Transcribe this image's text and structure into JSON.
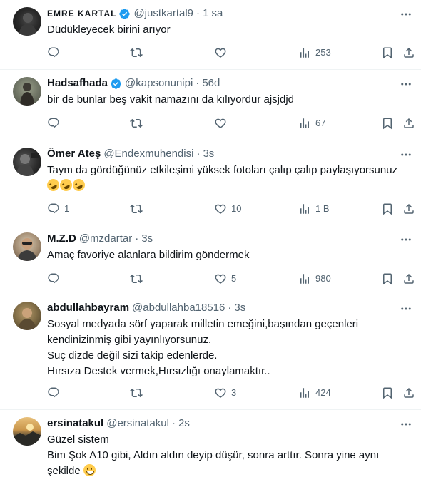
{
  "colors": {
    "text": "#0f1419",
    "secondary": "#536471",
    "verified_badge": "#1d9bf0",
    "divider": "#eff3f4"
  },
  "icons": {
    "reply": "reply-icon",
    "retweet": "retweet-icon",
    "like": "heart-icon",
    "views": "views-chart-icon",
    "bookmark": "bookmark-icon",
    "share": "share-icon",
    "more": "more-options-icon"
  },
  "tweets": [
    {
      "display_name": "ΕΜRΕ ΚΑRΤΑL",
      "verified": true,
      "handle": "@justkartal9",
      "time": "1 sa",
      "lines": [
        "Düdükleyecek birini arıyor"
      ],
      "replies": "",
      "retweets": "",
      "likes": "",
      "views": "253"
    },
    {
      "display_name": "Hadsafhada",
      "verified": true,
      "handle": "@kapsonunipi",
      "time": "56d",
      "lines": [
        "bir de bunlar beş vakit namazını da kılıyordur ajsjdjd"
      ],
      "replies": "",
      "retweets": "",
      "likes": "",
      "views": "67"
    },
    {
      "display_name": "Ömer Ateş",
      "verified": false,
      "handle": "@Endexmuhendisi",
      "time": "3s",
      "lines": [
        "Taym da gördüğünüz etkileşimi yüksek fotoları çalıp çalıp paylaşıyorsunuz"
      ],
      "replies": "1",
      "retweets": "",
      "likes": "10",
      "views": "1 B"
    },
    {
      "display_name": "M.Z.D",
      "verified": false,
      "handle": "@mzdartar",
      "time": "3s",
      "lines": [
        "Amaç favoriye alanlara bildirim göndermek"
      ],
      "replies": "",
      "retweets": "",
      "likes": "5",
      "views": "980"
    },
    {
      "display_name": "abdullahbayram",
      "verified": false,
      "handle": "@abdullahba18516",
      "time": "3s",
      "lines": [
        "Sosyal medyada sörf yaparak milletin emeğini,başından geçenleri",
        "kendinizinmiş gibi yayınlıyorsunuz.",
        "Suç dizde değil sizi takip edenlerde.",
        "Hırsıza Destek vermek,Hırsızlığı onaylamaktır.."
      ],
      "replies": "",
      "retweets": "",
      "likes": "3",
      "views": "424"
    },
    {
      "display_name": "ersinatakul",
      "verified": false,
      "handle": "@ersinatakul",
      "time": "2s",
      "lines": [
        "Güzel sistem",
        "Bim Şok A10 gibi, Aldın aldın deyip düşür, sonra arttır. Sonra yine aynı",
        "şekilde"
      ]
    }
  ]
}
